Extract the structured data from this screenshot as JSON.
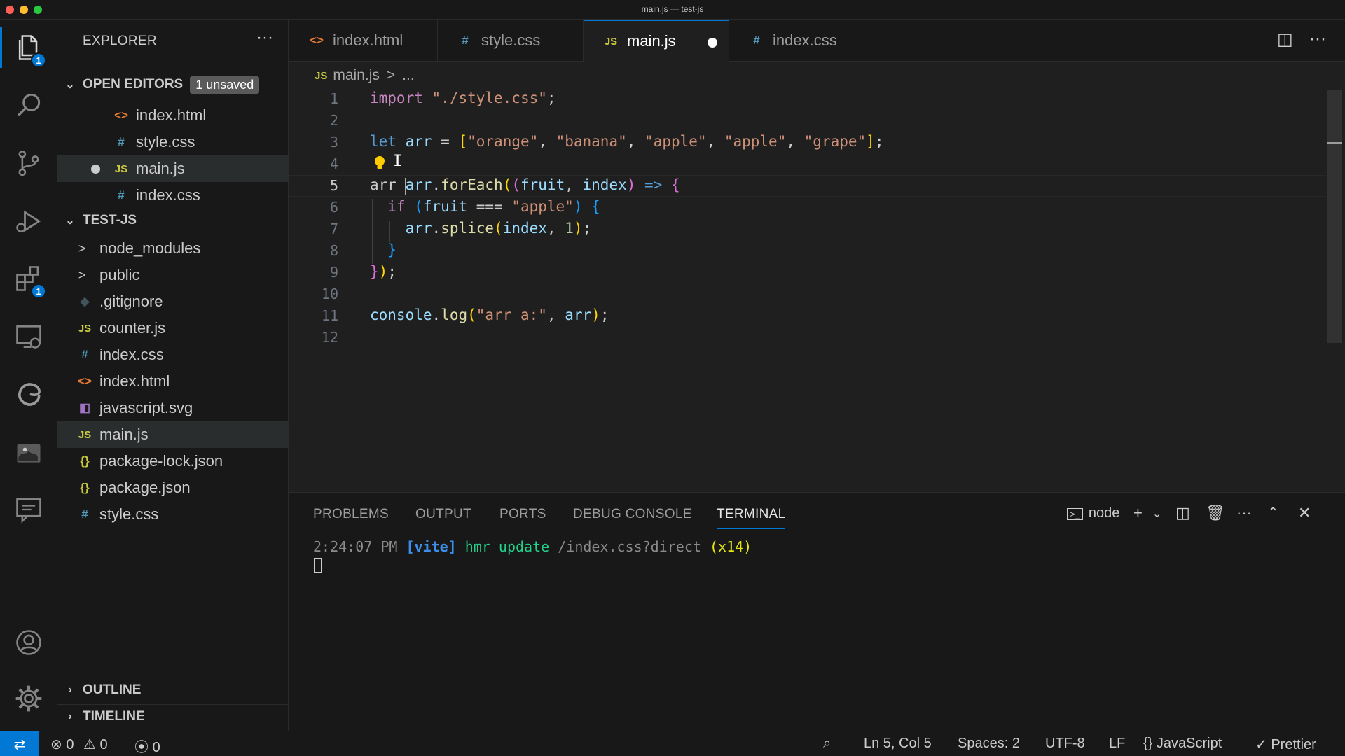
{
  "window": {
    "title": "main.js — test-js"
  },
  "activity": {
    "explorer_badge": "1",
    "extensions_badge": "1"
  },
  "sidebar": {
    "title": "EXPLORER",
    "open_editors": {
      "label": "OPEN EDITORS",
      "badge": "1 unsaved",
      "items": [
        {
          "name": "index.html",
          "icon": "<>"
        },
        {
          "name": "style.css",
          "icon": "#"
        },
        {
          "name": "main.js",
          "icon": "JS"
        },
        {
          "name": "index.css",
          "icon": "#"
        }
      ]
    },
    "folder": {
      "label": "TEST-JS",
      "items": [
        {
          "name": "node_modules",
          "icon": ">"
        },
        {
          "name": "public",
          "icon": ">"
        },
        {
          "name": ".gitignore",
          "icon": "◆"
        },
        {
          "name": "counter.js",
          "icon": "JS"
        },
        {
          "name": "index.css",
          "icon": "#"
        },
        {
          "name": "index.html",
          "icon": "<>"
        },
        {
          "name": "javascript.svg",
          "icon": "◧"
        },
        {
          "name": "main.js",
          "icon": "JS"
        },
        {
          "name": "package-lock.json",
          "icon": "{}"
        },
        {
          "name": "package.json",
          "icon": "{}"
        },
        {
          "name": "style.css",
          "icon": "#"
        }
      ]
    },
    "outline_label": "OUTLINE",
    "timeline_label": "TIMELINE"
  },
  "tabs": [
    {
      "name": "index.html",
      "icon": "<>"
    },
    {
      "name": "style.css",
      "icon": "#"
    },
    {
      "name": "main.js",
      "icon": "JS"
    },
    {
      "name": "index.css",
      "icon": "#"
    }
  ],
  "breadcrumb": {
    "icon": "JS",
    "file": "main.js",
    "sep": ">",
    "rest": "..."
  },
  "editor": {
    "line_numbers": [
      "1",
      "2",
      "3",
      "4",
      "5",
      "6",
      "7",
      "8",
      "9",
      "10",
      "11",
      "12"
    ],
    "current_line": "5",
    "code": {
      "l1_kw": "import",
      "l1_str": "\"./style.css\"",
      "l1_end": ";",
      "l3_kw": "let",
      "l3_var": "arr",
      "l3_eq": " = ",
      "l3_open": "[",
      "l3_s1": "\"orange\"",
      "l3_s2": "\"banana\"",
      "l3_s3": "\"apple\"",
      "l3_s4": "\"apple\"",
      "l3_s5": "\"grape\"",
      "l3_comma": ", ",
      "l3_close": "]",
      "l3_end": ";",
      "l5_pre": "arr ",
      "l5_var": "arr",
      "l5_dot": ".",
      "l5_fn": "forEach",
      "l5_op": "(",
      "l5_op2": "(",
      "l5_p1": "fruit",
      "l5_comma": ", ",
      "l5_p2": "index",
      "l5_cp": ")",
      "l5_arrow": " => ",
      "l5_brace": "{",
      "l6_kw": "if",
      "l6_op": " (",
      "l6_var": "fruit",
      "l6_eq": " === ",
      "l6_str": "\"apple\"",
      "l6_cp": ")",
      "l6_brace": " {",
      "l7_var": "arr",
      "l7_dot": ".",
      "l7_fn": "splice",
      "l7_op": "(",
      "l7_arg": "index",
      "l7_comma": ", ",
      "l7_num": "1",
      "l7_cp": ")",
      "l7_end": ";",
      "l8_brace": "}",
      "l9_brace": "}",
      "l9_cp": ")",
      "l9_end": ";",
      "l11_var": "console",
      "l11_dot": ".",
      "l11_fn": "log",
      "l11_op": "(",
      "l11_str": "\"arr a:\"",
      "l11_comma": ", ",
      "l11_arg": "arr",
      "l11_cp": ")",
      "l11_end": ";"
    }
  },
  "panel": {
    "tabs": [
      "PROBLEMS",
      "OUTPUT",
      "PORTS",
      "DEBUG CONSOLE",
      "TERMINAL"
    ],
    "active_tab": "TERMINAL",
    "terminal_name": "node",
    "terminal": {
      "time": "2:24:07 PM",
      "tag": "[vite]",
      "msg": "hmr update",
      "path": "/index.css?direct",
      "count": "(x14)"
    }
  },
  "statusbar": {
    "errors": "0",
    "warnings": "0",
    "ports": "0",
    "position": "Ln 5, Col 5",
    "spaces": "Spaces: 2",
    "encoding": "UTF-8",
    "eol": "LF",
    "language": "JavaScript",
    "formatter": "Prettier"
  },
  "colors": {
    "accent": "#0078d4",
    "background": "#1f1f1f",
    "sidebar": "#181818"
  }
}
